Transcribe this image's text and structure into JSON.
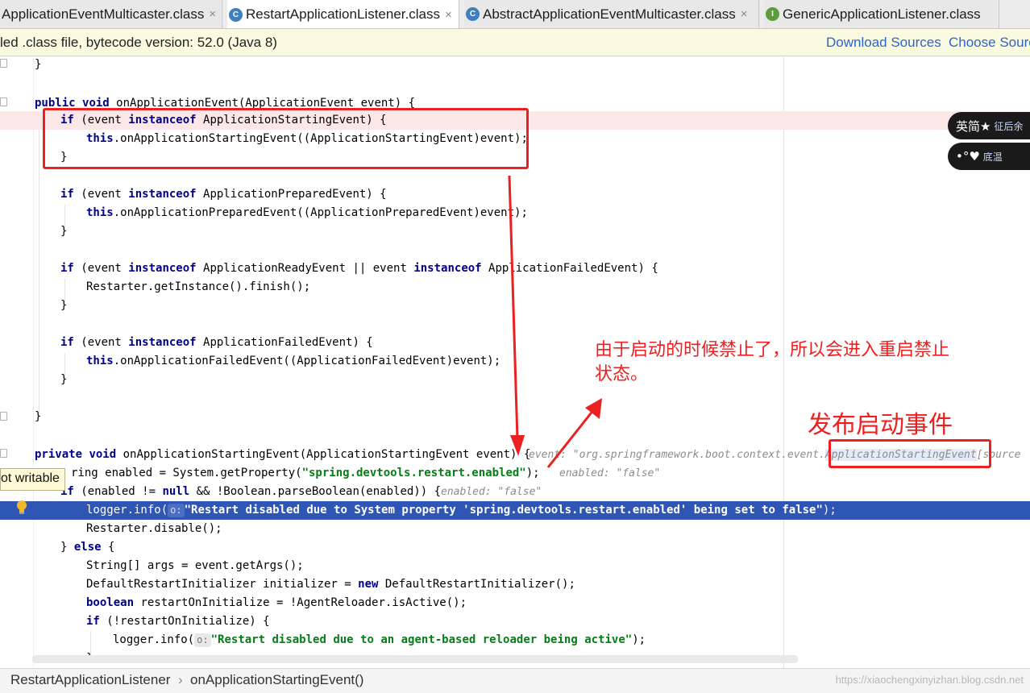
{
  "tabs": [
    {
      "label": "ApplicationEventMulticaster.class",
      "icon": "class-icon",
      "active": false
    },
    {
      "label": "RestartApplicationListener.class",
      "icon": "class-icon",
      "active": true
    },
    {
      "label": "AbstractApplicationEventMulticaster.class",
      "icon": "class-icon",
      "active": false
    },
    {
      "label": "GenericApplicationListener.class",
      "icon": "interface-icon",
      "active": false
    }
  ],
  "tab_icon_letters": {
    "class": "C",
    "interface": "I"
  },
  "tab_close_glyph": "×",
  "notice": {
    "text": "led .class file, bytecode version: 52.0 (Java 8)",
    "download_sources": "Download Sources",
    "choose_sources": "Choose Sources..."
  },
  "code": {
    "l01": "}",
    "l03_kw1": "public",
    "l03_kw2": "void",
    "l03_rest": " onApplicationEvent(ApplicationEvent event) {",
    "l04_kw": "if",
    "l04_a": " (event ",
    "l04_kw2": "instanceof",
    "l04_b": " ApplicationStartingEvent) {",
    "l05_kw": "this",
    "l05_rest": ".onApplicationStartingEvent((ApplicationStartingEvent)event);",
    "l06": "}",
    "l08_kw": "if",
    "l08_a": " (event ",
    "l08_kw2": "instanceof",
    "l08_b": " ApplicationPreparedEvent) {",
    "l09_kw": "this",
    "l09_rest": ".onApplicationPreparedEvent((ApplicationPreparedEvent)event);",
    "l10": "}",
    "l12_kw": "if",
    "l12_a": " (event ",
    "l12_kw2": "instanceof",
    "l12_b": " ApplicationReadyEvent || event ",
    "l12_kw3": "instanceof",
    "l12_c": " ApplicationFailedEvent) {",
    "l13": "Restarter.getInstance().finish();",
    "l14": "}",
    "l16_kw": "if",
    "l16_a": " (event ",
    "l16_kw2": "instanceof",
    "l16_b": " ApplicationFailedEvent) {",
    "l17_kw": "this",
    "l17_rest": ".onApplicationFailedEvent((ApplicationFailedEvent)event);",
    "l18": "}",
    "l20": "}",
    "l22_kw1": "private",
    "l22_kw2": "void",
    "l22_rest": " onApplicationStartingEvent(ApplicationStartingEvent event) {",
    "l22_hint_a": "event: \"org.springframework.boot.context.event.",
    "l22_hint_b": "ApplicationStartingEvent",
    "l22_hint_c": "[source",
    "l23_a": "ring enabled = System.getProperty(",
    "l23_str": "\"spring.devtools.restart.enabled\"",
    "l23_b": ");",
    "l23_hint": "enabled: \"false\"",
    "l24_kw": "if",
    "l24_a": " (enabled != ",
    "l24_kw2": "null",
    "l24_b": " && !Boolean.parseBoolean(enabled)) {",
    "l24_hint": "enabled: \"false\"",
    "l25_a": "logger.info(",
    "l25_param": "o:",
    "l25_str": "\"Restart disabled due to System property 'spring.devtools.restart.enabled' being set to false\"",
    "l25_b": ");",
    "l26": "Restarter.disable();",
    "l27_a": "} ",
    "l27_kw": "else",
    "l27_b": " {",
    "l28": "String[] args = event.getArgs();",
    "l29_a": "DefaultRestartInitializer initializer = ",
    "l29_kw": "new",
    "l29_b": " DefaultRestartInitializer();",
    "l30_kw": "boolean",
    "l30_rest": " restartOnInitialize = !AgentReloader.isActive();",
    "l31_kw": "if",
    "l31_rest": " (!restartOnInitialize) {",
    "l32_a": "logger.info(",
    "l32_param": "o:",
    "l32_str": "\"Restart disabled due to an agent-based reloader being active\"",
    "l32_b": ");",
    "l33": "}"
  },
  "annotations": {
    "note": "由于启动的时候禁止了，所以会进入重启禁止",
    "note_line2": "状态。",
    "publish": "发布启动事件"
  },
  "colors": {
    "annotation_red": "#ec2020",
    "selection_blue": "#2f56b4",
    "keyword": "#00008b",
    "string": "#067d17",
    "link": "#2d64c8"
  },
  "side_badges": [
    {
      "main": "英简★",
      "sub": "征后余"
    },
    {
      "main": "•°♥",
      "sub": "底温"
    }
  ],
  "tooltip": "ot writable",
  "breadcrumb": {
    "class": "RestartApplicationListener",
    "separator": "›",
    "method": "onApplicationStartingEvent()"
  },
  "watermark": "https://xiaochengxinyizhan.blog.csdn.net"
}
